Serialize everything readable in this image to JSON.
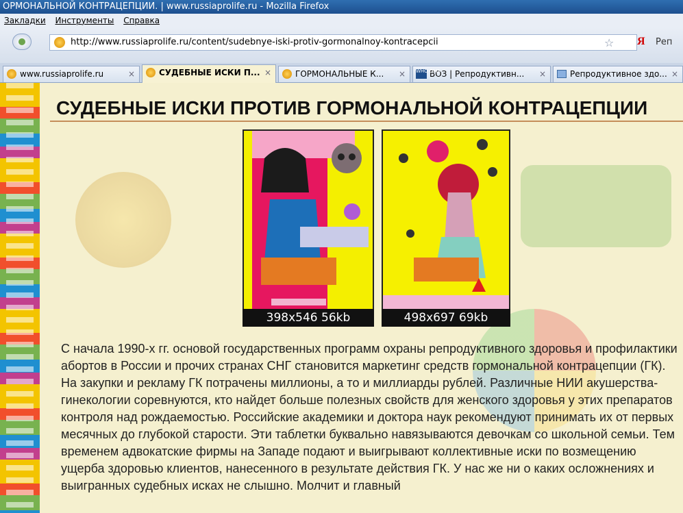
{
  "window": {
    "title": "ОРМОНАЛЬНОЙ КОНТРАЦЕПЦИИ. | www.russiaprolife.ru - Mozilla Firefox"
  },
  "menu": {
    "items": [
      "Закладки",
      "Инструменты",
      "Справка"
    ]
  },
  "address": {
    "url": "http://www.russiaprolife.ru/content/sudebnye-iski-protiv-gormonalnoy-kontracepcii"
  },
  "toolbar": {
    "star": "☆",
    "yandex": "Я",
    "yandex_text": "Реп"
  },
  "tabs": [
    {
      "label": "www.russiaprolife.ru"
    },
    {
      "label": "СУДЕБНЫЕ ИСКИ П..."
    },
    {
      "label": "ГОРМОНАЛЬНЫЕ К..."
    },
    {
      "label": "ВОЗ | Репродуктивн..."
    },
    {
      "label": "Репродуктивное здо..."
    }
  ],
  "tab_icons": {
    "who": "WHO OMS"
  },
  "close_glyph": "×",
  "article": {
    "title": "СУДЕБНЫЕ ИСКИ ПРОТИВ ГОРМОНАЛЬНОЙ КОНТРАЦЕПЦИИ",
    "images": [
      {
        "caption": "398x546 56kb"
      },
      {
        "caption": "498x697 69kb"
      }
    ],
    "body": "С начала 1990-х гг. основой государственных программ охраны репродуктивного здоровья и профилактики абортов в России и прочих странах СНГ становится маркетинг средств гормональной контрацепции (ГК). На закупки и рекламу ГК потрачены миллионы, а то и миллиарды рублей. Различные НИИ акушерства-гинекологии соревнуются, кто найдет больше полезных свойств для женского здоровья у этих препаратов контроля над рождаемостью. Российские академики и доктора наук рекомендуют принимать их от первых месячных до глубокой старости. Эти таблетки буквально навязываются девочкам со школьной семьи. Тем временем адвокатские фирмы на Западе подают и выигрывают коллективные иски по возмещению ущерба здоровью клиентов, нанесенного в результате действия ГК. У нас же ни о каких осложнениях и выигранных судебных исках не слышно. Молчит и главный"
  }
}
